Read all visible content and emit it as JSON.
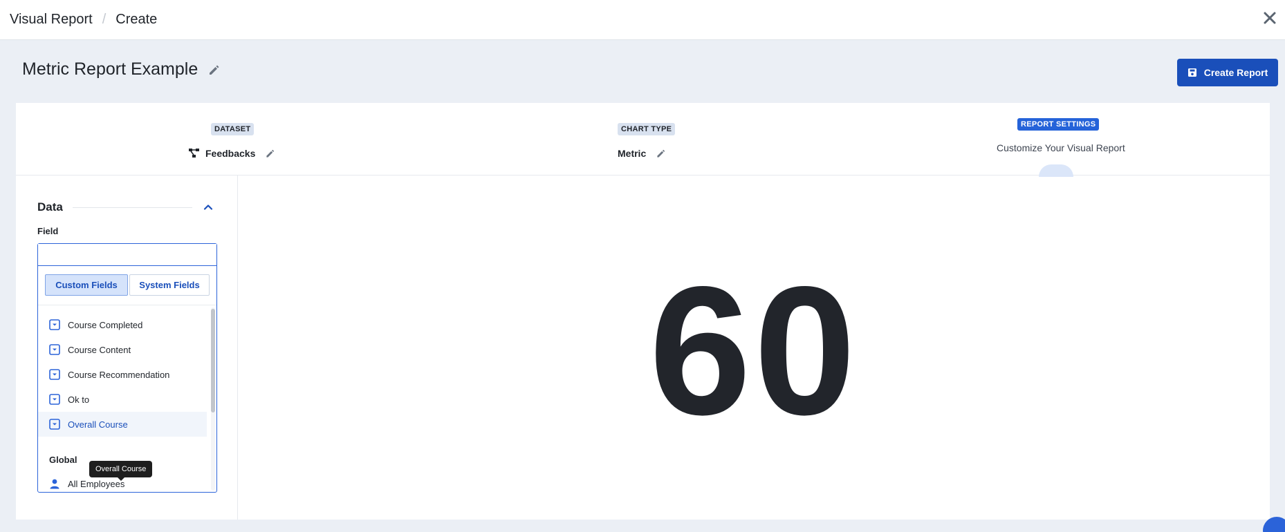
{
  "breadcrumb": {
    "root": "Visual Report",
    "separator": "/",
    "current": "Create"
  },
  "page": {
    "title": "Metric Report Example"
  },
  "actions": {
    "create_label": "Create Report"
  },
  "steps": {
    "dataset": {
      "tag": "DATASET",
      "value": "Feedbacks"
    },
    "chart_type": {
      "tag": "CHART TYPE",
      "value": "Metric"
    },
    "report_settings": {
      "tag": "REPORT SETTINGS",
      "subtitle": "Customize Your Visual Report"
    }
  },
  "data_panel": {
    "title": "Data",
    "field_label": "Field",
    "search_value": "",
    "tabs": {
      "custom": "Custom Fields",
      "system": "System Fields"
    },
    "items": [
      {
        "label": "Course Completed"
      },
      {
        "label": "Course Content"
      },
      {
        "label": "Course Recommendation"
      },
      {
        "label": "Ok to"
      },
      {
        "label": "Overall Course"
      }
    ],
    "group_label": "Global",
    "global_items": [
      {
        "label": "All Employees"
      }
    ],
    "tooltip": "Overall Course"
  },
  "metric": {
    "value": "60"
  },
  "colors": {
    "primary": "#1a4fba",
    "accent": "#2563d9",
    "background": "#ebeff5"
  }
}
